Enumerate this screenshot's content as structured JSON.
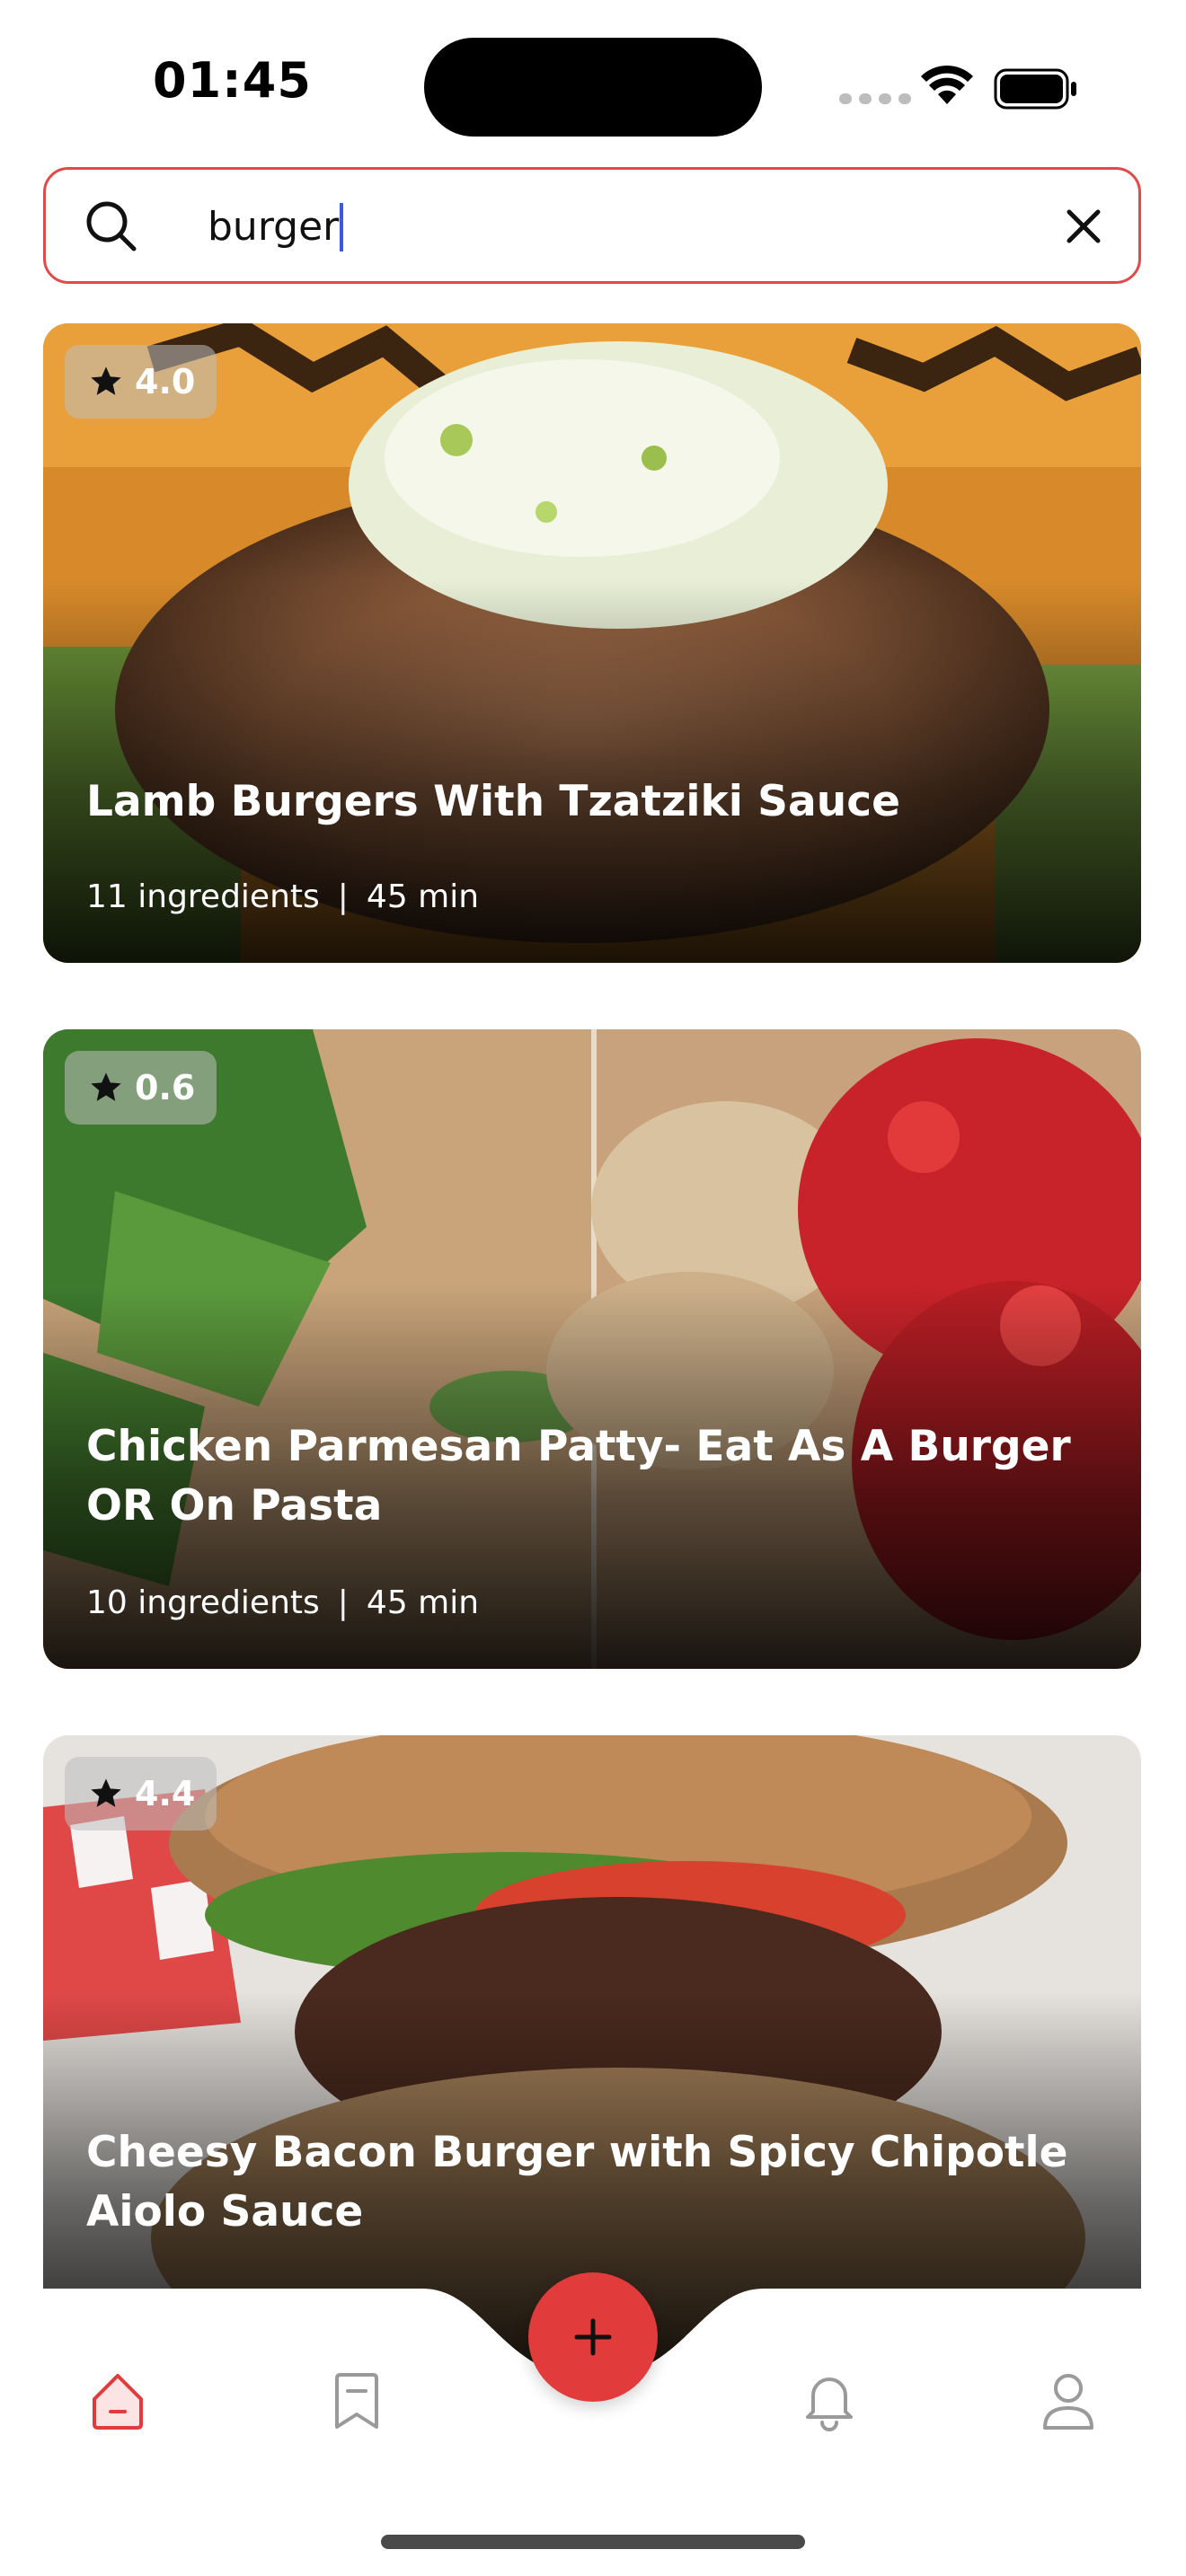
{
  "status_bar": {
    "time": "01:45"
  },
  "search": {
    "value": "burger"
  },
  "recipes": [
    {
      "rating": "4.0",
      "title": "Lamb Burgers With Tzatziki Sauce",
      "ingredients": "11 ingredients",
      "separator": "|",
      "time": "45 min"
    },
    {
      "rating": "0.6",
      "title": "Chicken Parmesan Patty- Eat As A Burger OR On Pasta",
      "ingredients": "10 ingredients",
      "separator": "|",
      "time": "45 min"
    },
    {
      "rating": "4.4",
      "title": "Cheesy Bacon Burger with Spicy Chipotle Aiolo Sauce"
    }
  ],
  "bottom_nav": {
    "items": [
      "home-icon",
      "bookmark-icon",
      "add-icon",
      "bell-icon",
      "profile-icon"
    ],
    "active": "home-icon"
  },
  "colors": {
    "accent": "#e23b3b",
    "search_border": "#e24a4a",
    "caret": "#3b5bdb"
  }
}
